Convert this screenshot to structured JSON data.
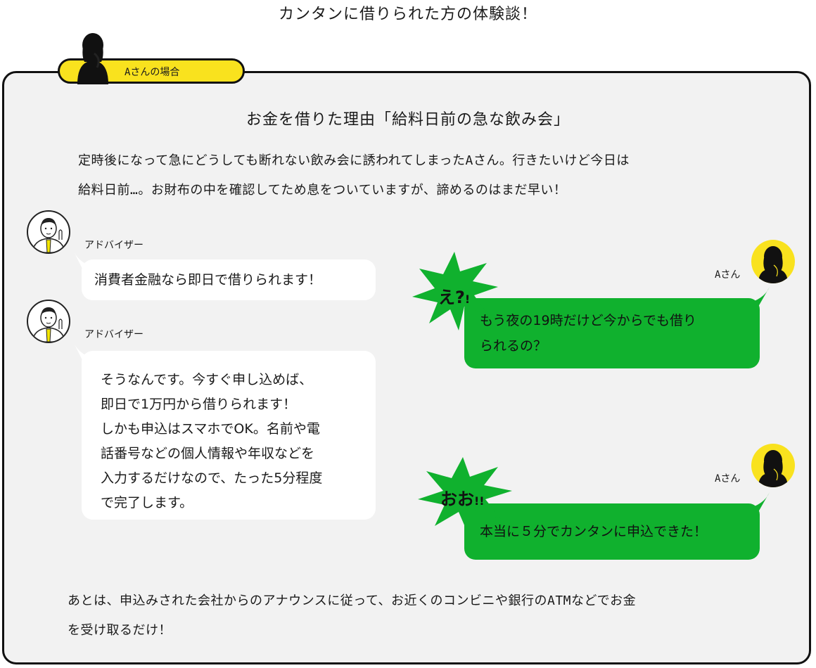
{
  "page_title": "カンタンに借りられた方の体験談！",
  "case_label": "Aさんの場合",
  "section_heading": "お金を借りた理由「給料日前の急な飲み会」",
  "intro_lines": [
    "定時後になって急にどうしても断れない飲み会に誘われてしまったAさん。行きたいけど今日は",
    "給料日前…。お財布の中を確認してため息をついていますが、諦めるのはまだ早い！"
  ],
  "chat": {
    "advisor_name": "アドバイザー",
    "user_name": "Aさん",
    "advisor_msg1": "消費者金融なら即日で借りられます！",
    "advisor_msg2_lines": [
      "そうなんです。今すぐ申し込めば、",
      "即日で1万円から借りられます！",
      "しかも申込はスマホでOK。名前や電",
      "話番号などの個人情報や年収などを",
      "入力するだけなので、たった5分程度",
      "で完了します。"
    ],
    "user_msg1_lines": [
      "もう夜の19時だけど今からでも借り",
      "られるの？"
    ],
    "user_msg2": "本当に５分でカンタンに申込できた！",
    "exclaim1_main": "え?",
    "exclaim1_small": "!",
    "exclaim2_main": "おお",
    "exclaim2_small": "!!"
  },
  "outro_lines": [
    "あとは、申込みされた会社からのアナウンスに従って、お近くのコンビニや銀行のATMなどでお金",
    "を受け取るだけ！"
  ],
  "colors": {
    "accent_yellow": "#f9e21e",
    "bubble_green": "#10b12e",
    "panel_bg": "#f2f2f2",
    "border": "#111111"
  },
  "icons": [
    "person-silhouette-icon",
    "advisor-avatar-icon",
    "user-avatar-icon",
    "burst-icon"
  ]
}
